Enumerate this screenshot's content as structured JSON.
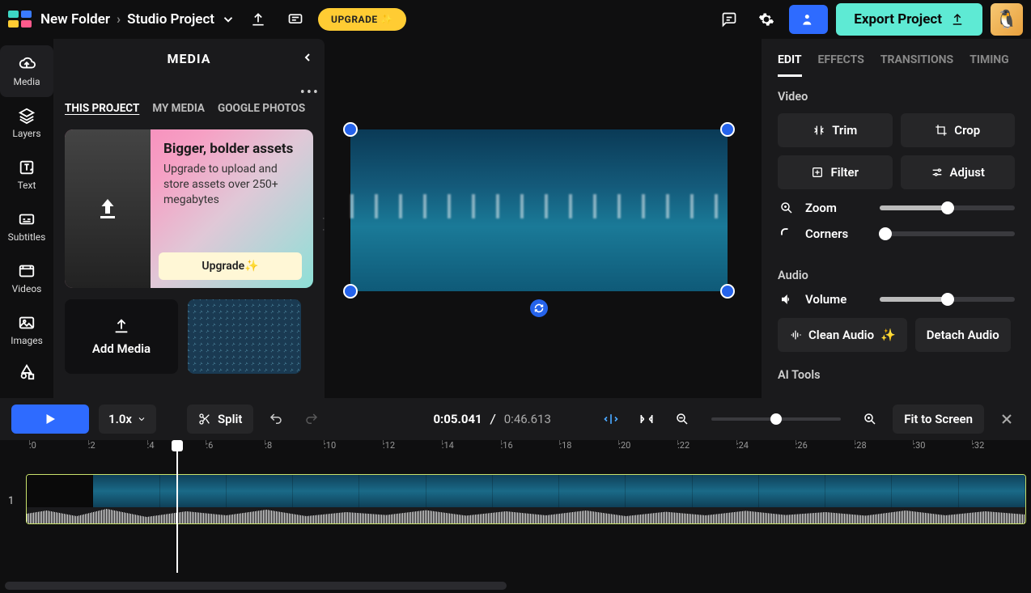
{
  "top": {
    "folder": "New Folder",
    "project": "Studio Project",
    "upgrade": "UPGRADE",
    "export": "Export Project"
  },
  "rail": {
    "items": [
      {
        "label": "Media"
      },
      {
        "label": "Layers"
      },
      {
        "label": "Text"
      },
      {
        "label": "Subtitles"
      },
      {
        "label": "Videos"
      },
      {
        "label": "Images"
      }
    ]
  },
  "panel": {
    "title": "MEDIA",
    "tabs": {
      "project": "THIS PROJECT",
      "my": "MY MEDIA",
      "google": "GOOGLE PHOTOS"
    },
    "promo": {
      "heading": "Bigger, bolder assets",
      "body": "Upgrade to upload and store assets over 250+ megabytes",
      "cta": "Upgrade"
    },
    "addMedia": "Add Media"
  },
  "rpanel": {
    "tabs": {
      "edit": "EDIT",
      "effects": "EFFECTS",
      "transitions": "TRANSITIONS",
      "timing": "TIMING"
    },
    "video": {
      "h": "Video",
      "trim": "Trim",
      "crop": "Crop",
      "filter": "Filter",
      "adjust": "Adjust",
      "zoom": "Zoom",
      "corners": "Corners"
    },
    "audio": {
      "h": "Audio",
      "volume": "Volume",
      "clean": "Clean Audio",
      "detach": "Detach Audio"
    },
    "ai": {
      "h": "AI Tools"
    }
  },
  "tctrl": {
    "speed": "1.0x",
    "split": "Split",
    "current": "0:05.041",
    "total": "0:46.613",
    "fit": "Fit to Screen"
  },
  "ruler": [
    ":0",
    ":2",
    ":4",
    ":6",
    ":8",
    ":10",
    ":12",
    ":14",
    ":16",
    ":18",
    ":20",
    ":22",
    ":24",
    ":26",
    ":28",
    ":30",
    ":32"
  ],
  "track": {
    "num": "1"
  },
  "sliders": {
    "zoom": 50,
    "corners": 0,
    "volume": 50
  }
}
